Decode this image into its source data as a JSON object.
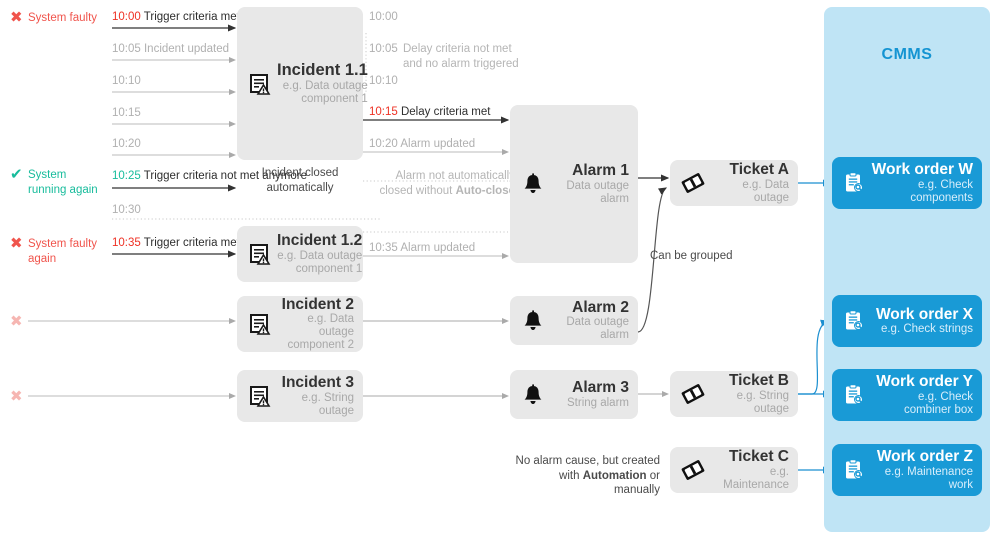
{
  "cmms": {
    "title": "CMMS"
  },
  "status_column": [
    {
      "icon": "x-mark-icon",
      "label": "System faulty",
      "color": "#f0544c",
      "state": "faulty"
    },
    {
      "icon": "check-mark-icon",
      "label": "System running again",
      "color": "#18bc9c",
      "state": "running"
    },
    {
      "icon": "x-mark-icon",
      "label": "System faulty again",
      "color": "#f0544c",
      "state": "faulty"
    },
    {
      "icon": "x-mark-icon",
      "label": "",
      "color": "#f6b6b2",
      "state": "faulty-faded"
    },
    {
      "icon": "x-mark-icon",
      "label": "",
      "color": "#f6b6b2",
      "state": "faulty-faded"
    }
  ],
  "incident_timeline": [
    {
      "time": "10:00",
      "time_color": "red",
      "desc": "Trigger criteria met",
      "desc_style": "dark"
    },
    {
      "time": "10:05",
      "time_color": "grey",
      "desc": "Incident updated",
      "desc_style": "grey"
    },
    {
      "time": "10:10",
      "time_color": "grey",
      "desc": "",
      "desc_style": "grey"
    },
    {
      "time": "10:15",
      "time_color": "grey",
      "desc": "",
      "desc_style": "grey"
    },
    {
      "time": "10:20",
      "time_color": "grey",
      "desc": "",
      "desc_style": "grey"
    },
    {
      "time": "10:25",
      "time_color": "green",
      "desc": "Trigger criteria not met anymore",
      "desc_style": "dark"
    },
    {
      "time": "10:30",
      "time_color": "grey",
      "desc": "",
      "desc_style": "grey"
    },
    {
      "time": "10:35",
      "time_color": "red",
      "desc": "Trigger criteria met again",
      "desc_style": "dark"
    }
  ],
  "alarm_timeline": [
    {
      "time": "10:00",
      "time_color": "grey",
      "desc": ""
    },
    {
      "time": "10:05",
      "time_color": "grey",
      "desc": "Delay criteria not met and no alarm triggered"
    },
    {
      "time": "10:10",
      "time_color": "grey",
      "desc": ""
    },
    {
      "time": "10:15",
      "time_color": "red",
      "desc": "Delay criteria met",
      "desc_style": "dark"
    },
    {
      "time": "10:20",
      "time_color": "grey",
      "desc": "Alarm updated"
    },
    {
      "time": "10:35",
      "time_color": "grey",
      "desc": "Alarm updated"
    }
  ],
  "notes": {
    "incident_closed": "Incident closed automatically",
    "alarm_not_closed_line1": "Alarm not automatically",
    "alarm_not_closed_line2_a": "closed without ",
    "alarm_not_closed_line2_b": "Auto-close",
    "can_be_grouped": "Can be grouped",
    "no_alarm_cause_line1": "No alarm cause, but created",
    "no_alarm_cause_line2_a": "with ",
    "no_alarm_cause_line2_b": "Automation",
    "no_alarm_cause_line2_c": " or manually"
  },
  "incidents": [
    {
      "id": "incident-11",
      "icon": "incident-document-icon",
      "title": "Incident 1.1",
      "sub1": "e.g. Data outage",
      "sub2": "component 1"
    },
    {
      "id": "incident-12",
      "icon": "incident-document-icon",
      "title": "Incident 1.2",
      "sub1": "e.g. Data outage",
      "sub2": "component 1"
    },
    {
      "id": "incident-2",
      "icon": "incident-document-icon",
      "title": "Incident 2",
      "sub1": "e.g. Data outage",
      "sub2": "component 2"
    },
    {
      "id": "incident-3",
      "icon": "incident-document-icon",
      "title": "Incident 3",
      "sub1": "e.g. String",
      "sub2": "outage"
    }
  ],
  "alarms": [
    {
      "id": "alarm-1",
      "icon": "bell-icon",
      "title": "Alarm 1",
      "sub1": "Data outage alarm",
      "sub2": ""
    },
    {
      "id": "alarm-2",
      "icon": "bell-icon",
      "title": "Alarm 2",
      "sub1": "Data outage alarm",
      "sub2": ""
    },
    {
      "id": "alarm-3",
      "icon": "bell-icon",
      "title": "Alarm 3",
      "sub1": "String alarm",
      "sub2": ""
    }
  ],
  "tickets": [
    {
      "id": "ticket-a",
      "icon": "ticket-icon",
      "title": "Ticket A",
      "sub1": "e.g. Data outage",
      "sub2": ""
    },
    {
      "id": "ticket-b",
      "icon": "ticket-icon",
      "title": "Ticket B",
      "sub1": "e.g. String outage",
      "sub2": ""
    },
    {
      "id": "ticket-c",
      "icon": "ticket-icon",
      "title": "Ticket C",
      "sub1": "e.g. Maintenance",
      "sub2": ""
    }
  ],
  "work_orders": [
    {
      "id": "wo-w",
      "icon": "clipboard-work-order-icon",
      "title": "Work order W",
      "sub1": "e.g. Check components"
    },
    {
      "id": "wo-x",
      "icon": "clipboard-work-order-icon",
      "title": "Work order X",
      "sub1": "e.g. Check strings"
    },
    {
      "id": "wo-y",
      "icon": "clipboard-work-order-icon",
      "title": "Work order Y",
      "sub1": "e.g. Check combiner box"
    },
    {
      "id": "wo-z",
      "icon": "clipboard-work-order-icon",
      "title": "Work order Z",
      "sub1": "e.g. Maintenance work"
    }
  ],
  "colors": {
    "cmms_panel": "#bfe4f5",
    "cmms_text": "#1494d2",
    "work_order": "#199ad6",
    "node_grey": "#e8e8e8",
    "fault_red": "#f0544c",
    "ok_green": "#18bc9c",
    "arrow_grey": "#aaaaaa",
    "arrow_dark": "#333333"
  }
}
